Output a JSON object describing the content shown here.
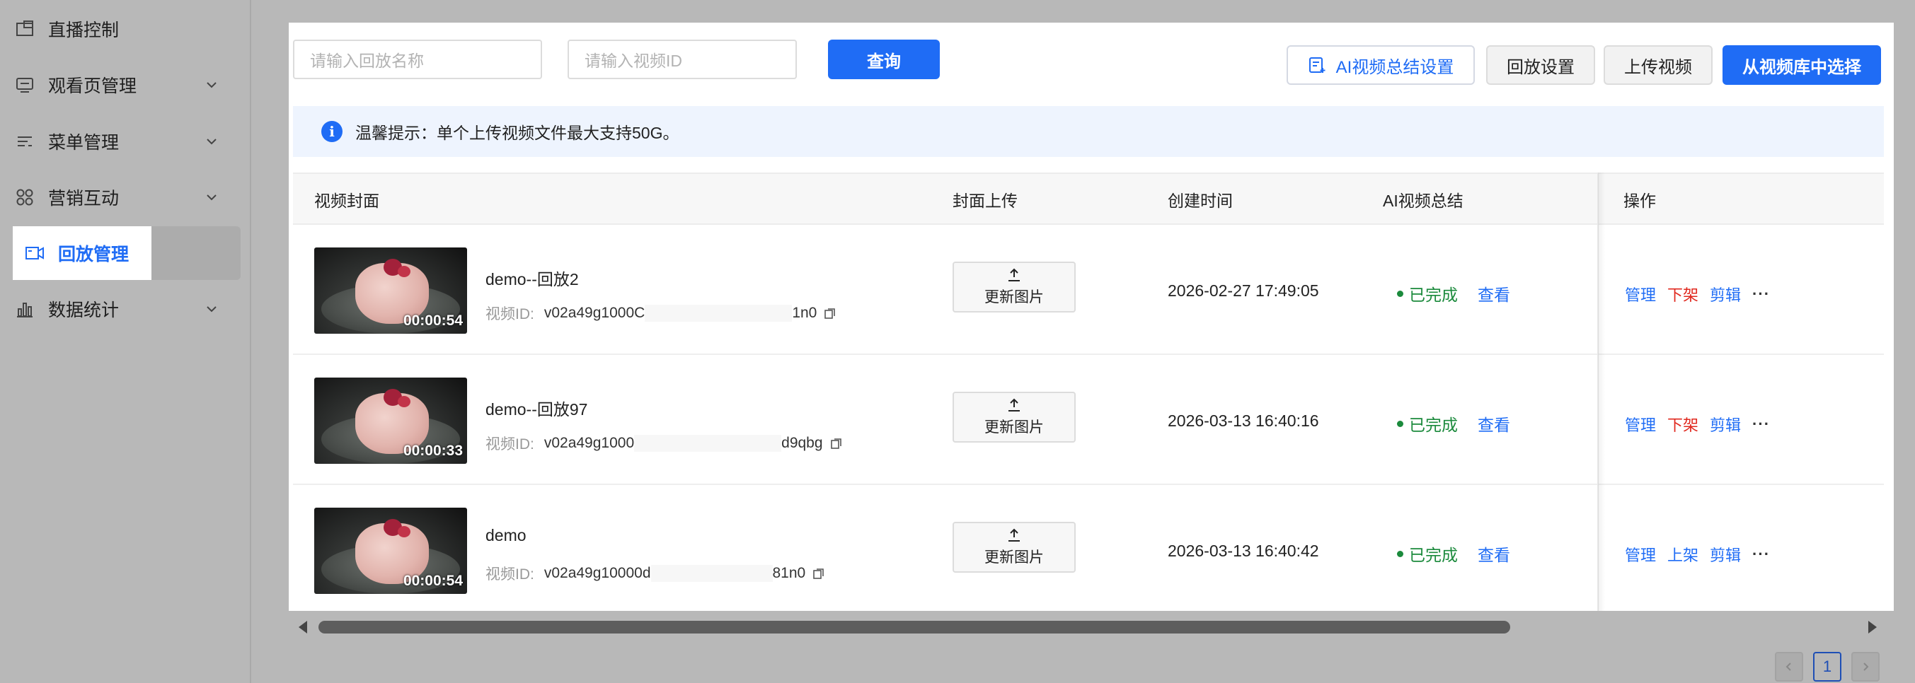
{
  "sidebar": {
    "items": [
      {
        "label": "直播控制",
        "icon": "live-control-icon",
        "has_chevron": false
      },
      {
        "label": "观看页管理",
        "icon": "monitor-icon",
        "has_chevron": true
      },
      {
        "label": "菜单管理",
        "icon": "menu-list-icon",
        "has_chevron": true
      },
      {
        "label": "营销互动",
        "icon": "grid-apps-icon",
        "has_chevron": true
      },
      {
        "label": "回放管理",
        "icon": "video-camera-icon",
        "has_chevron": false,
        "active": true
      },
      {
        "label": "数据统计",
        "icon": "bar-chart-icon",
        "has_chevron": true
      }
    ]
  },
  "toolbar": {
    "replay_name_placeholder": "请输入回放名称",
    "video_id_placeholder": "请输入视频ID",
    "search_label": "查询",
    "ai_summary_settings_label": "AI视频总结设置",
    "replay_settings_label": "回放设置",
    "upload_video_label": "上传视频",
    "choose_from_library_label": "从视频库中选择"
  },
  "notice": {
    "text": "温馨提示：单个上传视频文件最大支持50G。"
  },
  "table": {
    "headers": {
      "cover": "视频封面",
      "cover_upload": "封面上传",
      "created": "创建时间",
      "ai_summary": "AI视频总结",
      "actions": "操作"
    },
    "id_label": "视频ID:",
    "update_image_label": "更新图片",
    "view_label": "查看",
    "rows": [
      {
        "name": "demo--回放2",
        "duration": "00:00:54",
        "id_prefix": "v02a49g1000C",
        "id_suffix": "1n0",
        "created": "2026-02-27 17:49:05",
        "status": "已完成",
        "actions": [
          "管理",
          "下架",
          "剪辑",
          "···"
        ]
      },
      {
        "name": "demo--回放97",
        "duration": "00:00:33",
        "id_prefix": "v02a49g1000",
        "id_suffix": "d9qbg",
        "created": "2026-03-13 16:40:16",
        "status": "已完成",
        "actions": [
          "管理",
          "下架",
          "剪辑",
          "···"
        ]
      },
      {
        "name": "demo",
        "duration": "00:00:54",
        "id_prefix": "v02a49g10000d",
        "id_suffix": "81n0",
        "created": "2026-03-13 16:40:42",
        "status": "已完成",
        "actions": [
          "管理",
          "上架",
          "剪辑",
          "···"
        ]
      }
    ]
  },
  "pagination": {
    "current_page": "1"
  },
  "colors": {
    "primary": "#1f6cf5",
    "danger": "#e0281e",
    "success": "#1b8a3c"
  }
}
